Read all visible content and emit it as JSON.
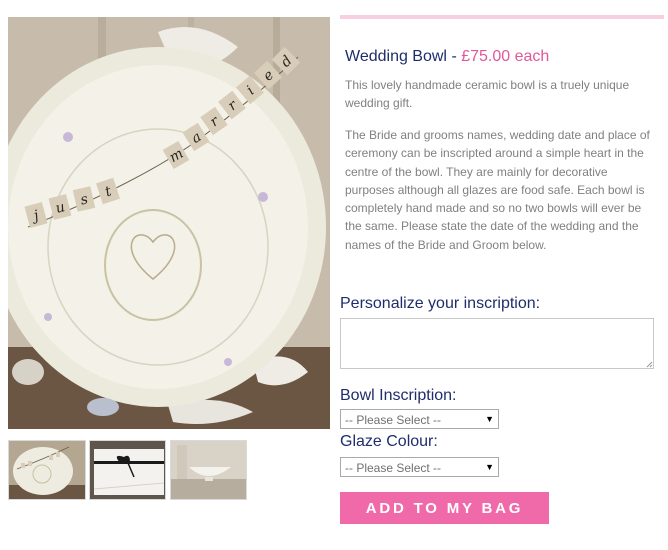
{
  "product": {
    "title": "Wedding Bowl",
    "separator": "-",
    "price": "£75.00 each",
    "description_1": "This lovely handmade ceramic bowl is a truely unique wedding gift.",
    "description_2": "The Bride and grooms names, wedding date and place of ceremony can be inscripted around a simple heart in the centre of the bowl. They are mainly for decorative purposes although all glazes are food safe. Each bowl is completely hand made and so no two bowls will ever be the same. Please state the date of the wedding and the names of the Bride and Groom below."
  },
  "photo": {
    "banner_letters": [
      "j",
      "u",
      "s",
      "t",
      "m",
      "a",
      "r",
      "r",
      "i",
      "e",
      "d"
    ]
  },
  "form": {
    "personalize_label": "Personalize your inscription:",
    "inscription_value": "",
    "bowl_label": "Bowl Inscription:",
    "bowl_selected": "-- Please Select --",
    "glaze_label": "Glaze Colour:",
    "glaze_selected": "-- Please Select --",
    "add_to_bag": "ADD TO MY BAG"
  },
  "colors": {
    "accent_pink": "#f06aaa",
    "price_pink": "#e0589b",
    "title_navy": "#1f2d6b",
    "rule_pink": "#f8cfe0"
  }
}
